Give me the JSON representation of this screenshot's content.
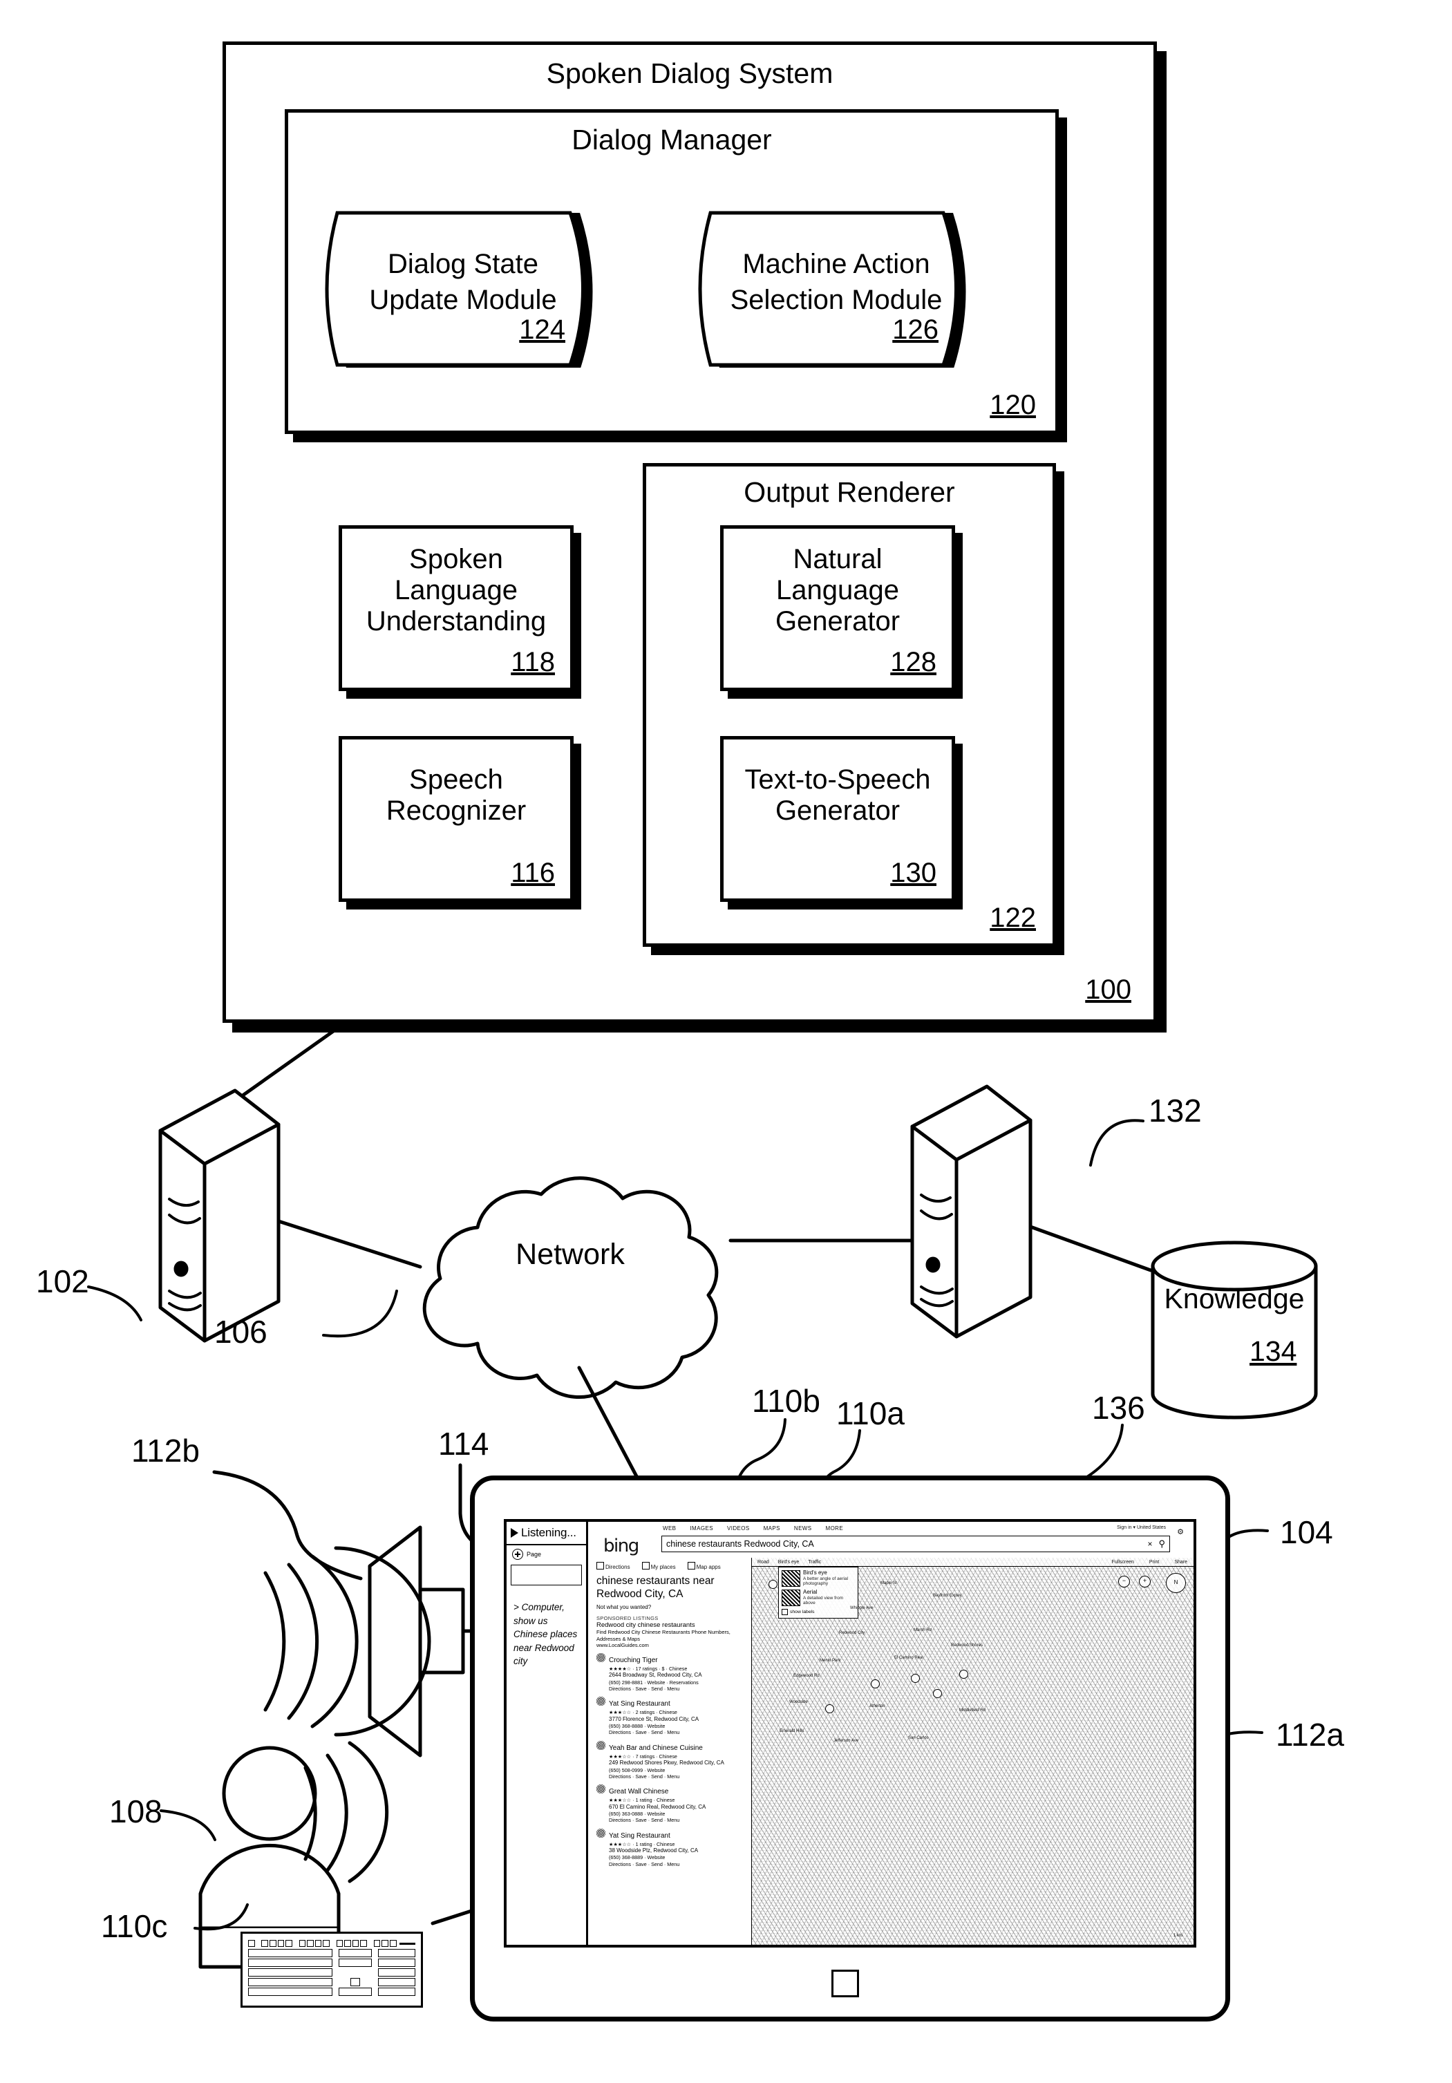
{
  "figure": {
    "system_title": "Spoken Dialog System",
    "system_ref": "100",
    "dialog_manager_title": "Dialog Manager",
    "dialog_manager_ref": "120",
    "output_renderer_title": "Output Renderer",
    "output_renderer_ref": "122"
  },
  "modules": {
    "dialog_state_update": {
      "line1": "Dialog State",
      "line2": "Update Module",
      "ref": "124"
    },
    "machine_action_selection": {
      "line1": "Machine Action",
      "line2": "Selection Module",
      "ref": "126"
    },
    "natural_language_generator": {
      "line1": "Natural",
      "line2": "Language",
      "line3": "Generator",
      "ref": "128"
    },
    "text_to_speech_generator": {
      "line1": "Text-to-Speech",
      "line2": "Generator",
      "ref": "130"
    },
    "spoken_language_understanding": {
      "line1": "Spoken",
      "line2": "Language",
      "line3": "Understanding",
      "ref": "118"
    },
    "speech_recognizer": {
      "line1": "Speech",
      "line2": "Recognizer",
      "ref": "116"
    }
  },
  "network": {
    "cloud_label": "Network",
    "cloud_ref": "106",
    "server_left_ref": "102",
    "server_right_ref": "132",
    "knowledge_label": "Knowledge",
    "knowledge_ref": "134"
  },
  "device": {
    "tablet_ref": "104",
    "display_ref": "136",
    "speaker_ref": "112b",
    "tablet_speaker_ref": "112a",
    "user_ref": "108",
    "mic_ref": "110a",
    "camera_ref": "110b",
    "keyboard_ref": "110c",
    "voice_pane_ref": "114"
  },
  "voice_pane": {
    "status": "Listening...",
    "page_label": "Page",
    "input_value": "",
    "utterance": "> Computer, show us Chinese places near Redwood city"
  },
  "bing": {
    "logo": "bing",
    "nav": [
      "WEB",
      "IMAGES",
      "VIDEOS",
      "MAPS",
      "NEWS",
      "MORE"
    ],
    "sign_in": "Sign in ▾\nUnited States",
    "gear_icon": "gear-icon",
    "query": "chinese restaurants Redwood City, CA",
    "clear_icon": "×",
    "search_icon": "⚲",
    "result_tabs": [
      "Directions",
      "My places",
      "Map apps"
    ],
    "results_title": "chinese restaurants near Redwood City, CA",
    "results_subtitle": "Not what you wanted?",
    "ad_label": "SPONSORED LISTINGS",
    "ad": {
      "headline": "Redwood city chinese restaurants",
      "line1": "Find Redwood City Chinese Restaurants Phone Numbers,",
      "line2": "Addresses & Maps",
      "line3": "www.LocalGuides.com"
    },
    "results": [
      {
        "name": "Crouching Tiger",
        "meta": "★★★★☆ · 17 ratings · $ · Chinese",
        "addr1": "2644 Broadway St, Redwood City, CA",
        "addr2": "(650) 298-8881 · Website · Reservations",
        "addr3": "Directions · Save · Send · Menu"
      },
      {
        "name": "Yat Sing Restaurant",
        "meta": "★★★☆☆ · 2 ratings · Chinese",
        "addr1": "3770 Florence St, Redwood City, CA",
        "addr2": "(650) 368-8888 · Website",
        "addr3": "Directions · Save · Send · Menu"
      },
      {
        "name": "Yeah Bar and Chinese Cuisine",
        "meta": "★★★☆☆ · 7 ratings · Chinese",
        "addr1": "249 Redwood Shores Pkwy, Redwood City, CA",
        "addr2": "(650) 508-0999 · Website",
        "addr3": "Directions · Save · Send · Menu"
      },
      {
        "name": "Great Wall Chinese",
        "meta": "★★★☆☆ · 1 rating · Chinese",
        "addr1": "670 El Camino Real, Redwood City, CA",
        "addr2": "(650) 363-0888 · Website",
        "addr3": "Directions · Save · Send · Menu"
      },
      {
        "name": "Yat Sing Restaurant",
        "meta": "★★★☆☆ · 1 rating · Chinese",
        "addr1": "38 Woodside Plz, Redwood City, CA",
        "addr2": "(650) 368-8889 · Website",
        "addr3": "Directions · Save · Send · Menu"
      }
    ],
    "map": {
      "toolbar": [
        "Road",
        "Bird's eye",
        "Traffic"
      ],
      "toolbar_right": [
        "Fullscreen",
        "Print",
        "Share"
      ],
      "selector": [
        {
          "title": "Bird's eye",
          "desc": "A better angle of aerial photography"
        },
        {
          "title": "Aerial",
          "desc": "A detailed view from above"
        }
      ],
      "show_labels": "show labels",
      "zoom_in": "+",
      "zoom_out": "−",
      "compass": "N",
      "scale": "1 km",
      "labels": [
        "Maple St",
        "Redwood City",
        "Marsh Rd",
        "Woodside",
        "Atherton",
        "Menlo Park",
        "Bayfront Expwy",
        "Redwood Shores",
        "Emerald Hills",
        "San Carlos",
        "Whipple Ave",
        "El Camino Real",
        "Edgewood Rd",
        "Middlefield Rd",
        "Jefferson Ave"
      ]
    }
  }
}
